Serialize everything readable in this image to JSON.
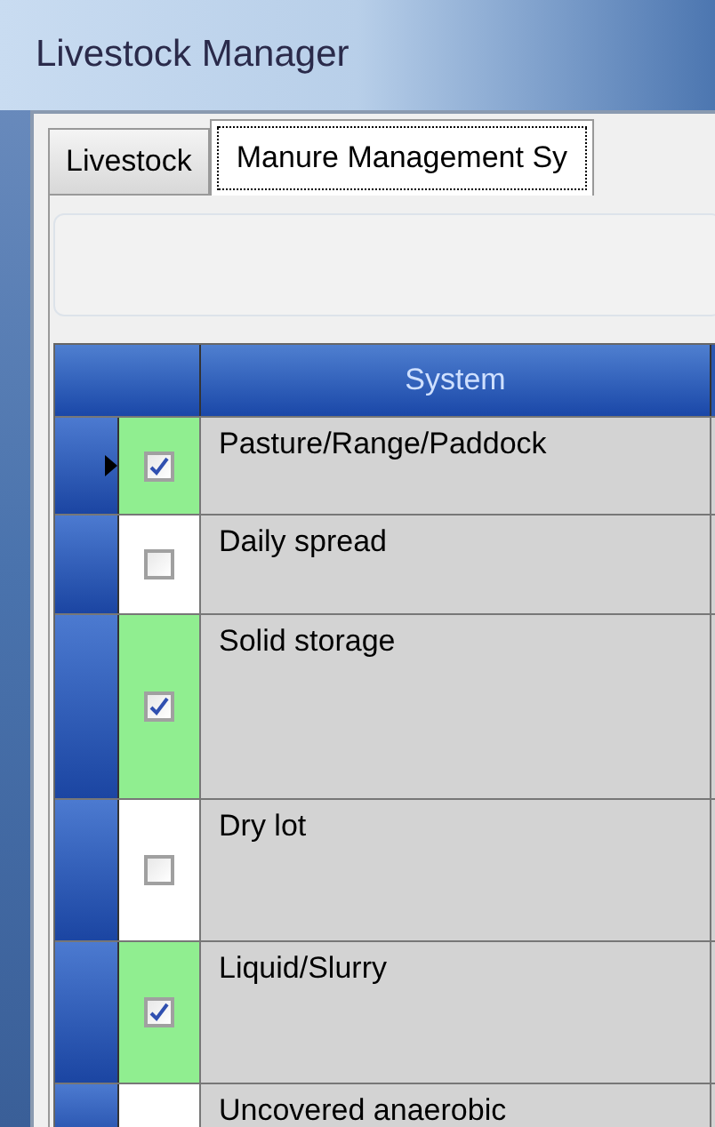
{
  "window": {
    "title": "Livestock Manager"
  },
  "tabs": [
    {
      "label": "Livestock",
      "selected": false
    },
    {
      "label": "Manure Management Sy",
      "selected": true
    }
  ],
  "table": {
    "columns": [
      "System"
    ],
    "rows": [
      {
        "system": "Pasture/Range/Paddock",
        "checked": true,
        "current": true
      },
      {
        "system": "Daily spread",
        "checked": false,
        "current": false
      },
      {
        "system": "Solid storage",
        "checked": true,
        "current": false
      },
      {
        "system": "Dry lot",
        "checked": false,
        "current": false
      },
      {
        "system": "Liquid/Slurry",
        "checked": true,
        "current": false
      },
      {
        "system": "Uncovered anaerobic"
      }
    ]
  }
}
